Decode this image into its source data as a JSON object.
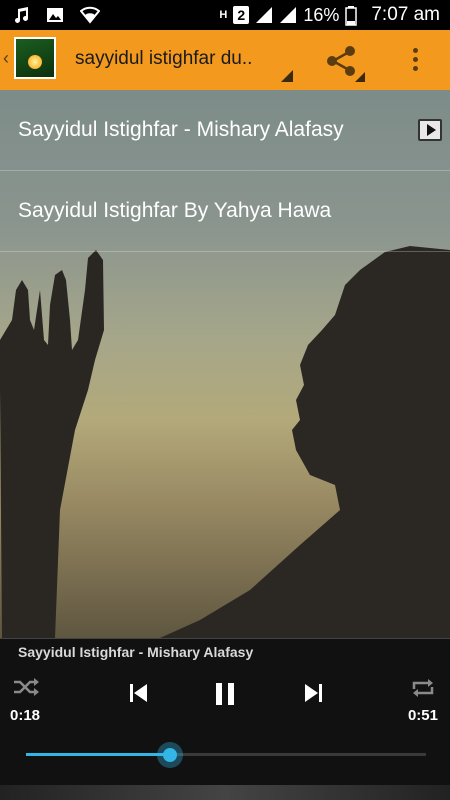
{
  "status_bar": {
    "icons": [
      "music-note-icon",
      "image-icon",
      "wifi-icon",
      "h-plus-icon",
      "sim-2-icon",
      "signal-icon",
      "signal-2-icon"
    ],
    "network_label": "H",
    "sim_label": "2",
    "battery": "16%",
    "time": "7:07 am"
  },
  "app_bar": {
    "title": "sayyidul istighfar du..",
    "logo_icon": "app-logo-icon",
    "share_icon": "share-icon",
    "overflow_icon": "more-vert-icon",
    "color": "#f39a1e"
  },
  "playlist": {
    "items": [
      {
        "label": "Sayyidul Istighfar - Mishary Alafasy",
        "playing": true
      },
      {
        "label": "Sayyidul Istighfar By Yahya Hawa",
        "playing": false
      }
    ]
  },
  "player": {
    "now_playing": "Sayyidul Istighfar - Mishary Alafasy",
    "current_time": "0:18",
    "duration": "0:51",
    "progress": 0.36,
    "accent": "#33b5e5",
    "controls": [
      "shuffle-icon",
      "previous-icon",
      "pause-icon",
      "next-icon",
      "repeat-icon"
    ]
  }
}
